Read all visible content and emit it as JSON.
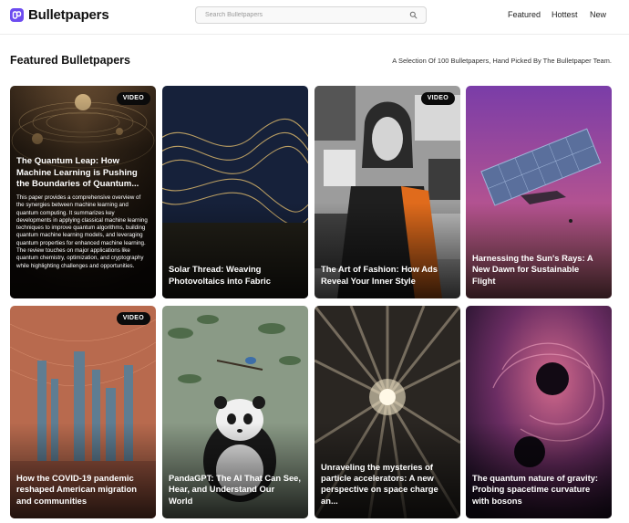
{
  "header": {
    "brand": "Bulletpapers",
    "search_placeholder": "Search Bulletpapers",
    "nav": [
      "Featured",
      "Hottest",
      "New"
    ]
  },
  "section": {
    "title": "Featured Bulletpapers",
    "subtitle": "A Selection Of 100 Bulletpapers, Hand Picked By The Bulletpaper Team."
  },
  "cards": [
    {
      "title": "The Quantum Leap: How Machine Learning is Pushing the Boundaries of Quantum...",
      "badge": "VIDEO",
      "description": "This paper provides a comprehensive overview of the synergies between machine learning and quantum computing. It summarizes key developments in applying classical machine learning techniques to improve quantum algorithms, building quantum machine learning models, and leveraging quantum properties for enhanced machine learning. The review touches on major applications like quantum chemistry, optimization, and cryptography while highlighting challenges and opportunities."
    },
    {
      "title": "Solar Thread: Weaving Photovoltaics into Fabric"
    },
    {
      "title": "The Art of Fashion: How Ads Reveal Your Inner Style",
      "badge": "VIDEO"
    },
    {
      "title": "Harnessing the Sun's Rays: A New Dawn for Sustainable Flight"
    },
    {
      "title": "How the COVID-19 pandemic reshaped American migration and communities",
      "badge": "VIDEO"
    },
    {
      "title": "PandaGPT: The AI That Can See, Hear, and Understand Our World"
    },
    {
      "title": "Unraveling the mysteries of particle accelerators: A new perspective on space charge an..."
    },
    {
      "title": "The quantum nature of gravity: Probing spacetime curvature with bosons"
    }
  ],
  "colors": {
    "brand": "#6d4cf0",
    "badge_bg": "#0b0b0b"
  },
  "icons": [
    "bulletpapers-logo-icon",
    "search-icon"
  ]
}
